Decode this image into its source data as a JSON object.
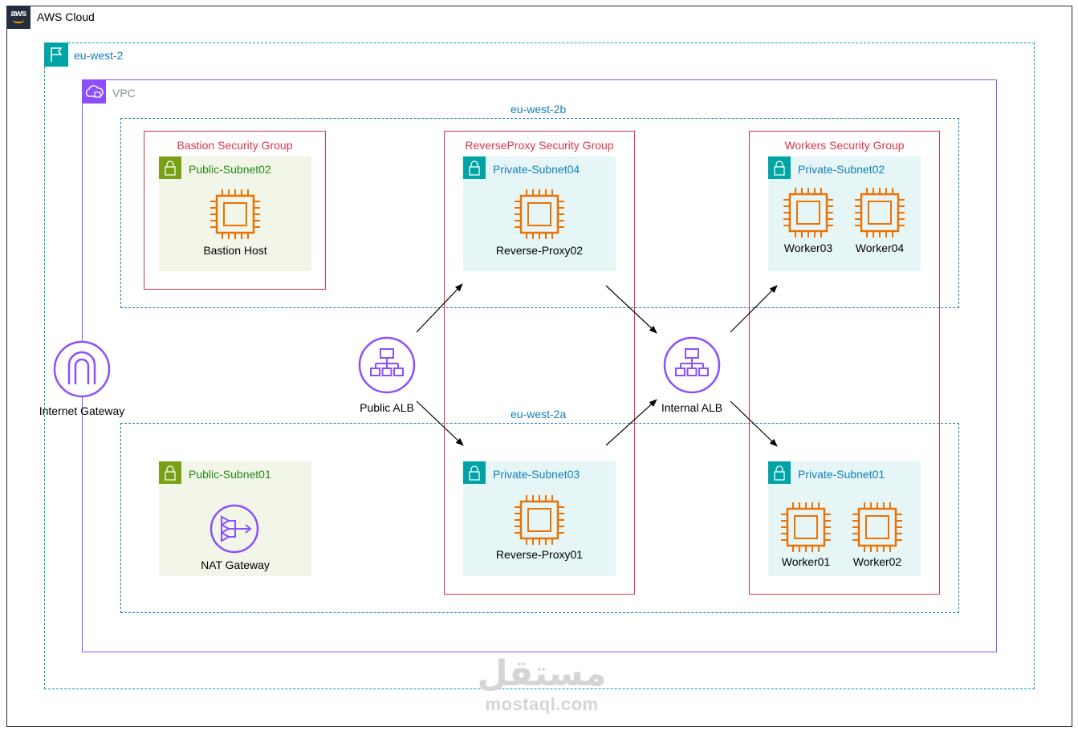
{
  "cloud": {
    "label": "AWS Cloud",
    "badge_text": "aws"
  },
  "region": {
    "label": "eu-west-2"
  },
  "vpc": {
    "label": "VPC"
  },
  "azs": {
    "top": "eu-west-2b",
    "bottom": "eu-west-2a"
  },
  "security_groups": {
    "bastion": "Bastion Security Group",
    "proxy": "ReverseProxy Security Group",
    "workers": "Workers Security Group"
  },
  "subnets": {
    "public02": "Public-Subnet02",
    "public01": "Public-Subnet01",
    "private04": "Private-Subnet04",
    "private03": "Private-Subnet03",
    "private02": "Private-Subnet02",
    "private01": "Private-Subnet01"
  },
  "nodes": {
    "bastion": "Bastion Host",
    "nat": "NAT Gateway",
    "proxy02": "Reverse-Proxy02",
    "proxy01": "Reverse-Proxy01",
    "worker03": "Worker03",
    "worker04": "Worker04",
    "worker01": "Worker01",
    "worker02": "Worker02",
    "igw": "Internet Gateway",
    "public_alb": "Public ALB",
    "internal_alb": "Internal ALB"
  },
  "watermark": {
    "arabic": "مستقل",
    "latin": "mostaql.com"
  },
  "colors": {
    "aws_dark": "#232f3e",
    "region": "#00a4a6",
    "vpc": "#8c4fff",
    "az": "#147eba",
    "security_group": "#dd344c",
    "public_subnet": "#7aa116",
    "private_subnet": "#00a4a6",
    "ec2": "#ed7100",
    "network": "#8c4fff"
  }
}
